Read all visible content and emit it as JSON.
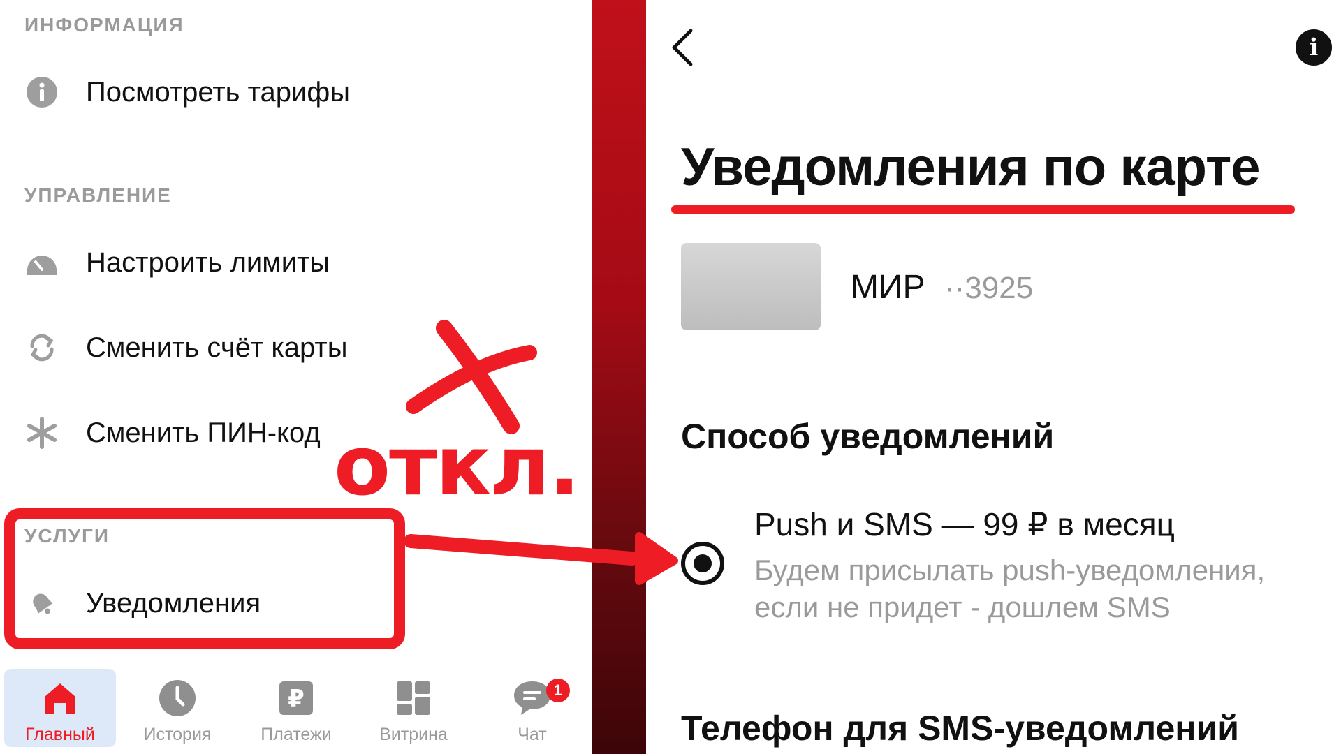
{
  "left": {
    "sections": {
      "info_header": "ИНФОРМАЦИЯ",
      "management_header": "УПРАВЛЕНИЕ",
      "services_header": "УСЛУГИ"
    },
    "items": {
      "tariffs": "Посмотреть тарифы",
      "limits": "Настроить лимиты",
      "change_account": "Сменить счёт карты",
      "change_pin": "Сменить ПИН-код",
      "notifications": "Уведомления"
    },
    "annotation": "откл.",
    "tabs": [
      {
        "label": "Главный",
        "icon": "home-icon",
        "active": true
      },
      {
        "label": "История",
        "icon": "clock-icon",
        "active": false
      },
      {
        "label": "Платежи",
        "icon": "ruble-icon",
        "active": false
      },
      {
        "label": "Витрина",
        "icon": "grid-icon",
        "active": false
      },
      {
        "label": "Чат",
        "icon": "chat-icon",
        "active": false,
        "badge": "1"
      }
    ]
  },
  "right": {
    "title": "Уведомления по карте",
    "card": {
      "name": "МИР",
      "number": "··3925"
    },
    "method_title": "Способ уведомлений",
    "option": {
      "title": "Push и SMS — 99 ₽ в месяц",
      "description": "Будем присылать push-уведомления, если не придет - дошлем SMS",
      "selected": true
    },
    "phone_title": "Телефон для SMS-уведомлений"
  },
  "colors": {
    "accent": "#ee1c25",
    "muted": "#9a9a9a",
    "text": "#111111",
    "active_tab_bg": "#dde9f8"
  }
}
